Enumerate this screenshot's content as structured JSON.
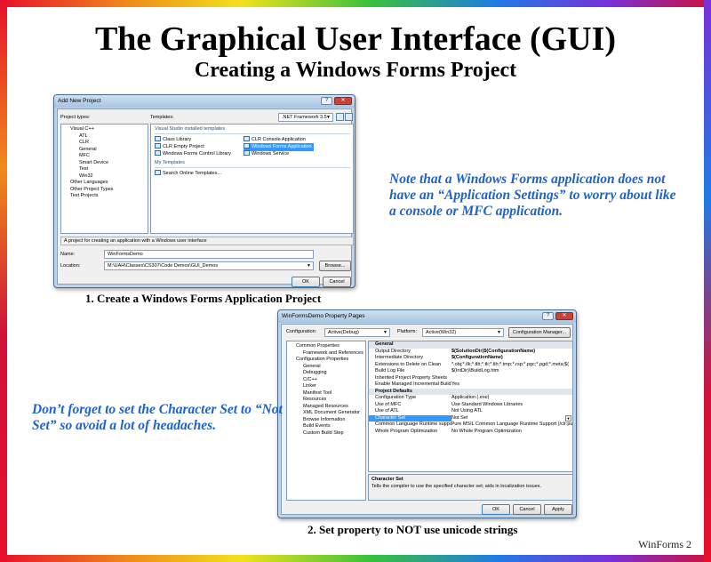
{
  "slide": {
    "title": "The Graphical User Interface (GUI)",
    "subtitle": "Creating a Windows Forms Project",
    "note_top": "Note that a Windows Forms application does not have an “Application Settings” to worry about like a console or MFC application.",
    "note_bottom": "Don’t forget to set the Character Set to “Not Set” so avoid a lot of headaches.",
    "caption_1": "1. Create a Windows Forms Application Project",
    "caption_2": "2. Set property to NOT use unicode strings",
    "slide_number": "WinForms 2"
  },
  "new_project_dialog": {
    "title": "Add New Project",
    "project_types_label": "Project types:",
    "project_types": [
      "Visual C++",
      "ATL",
      "CLR",
      "General",
      "MFC",
      "Smart Device",
      "Test",
      "Win32",
      "Other Languages",
      "Other Project Types",
      "Test Projects"
    ],
    "templates_label": "Templates:",
    "framework": ".NET Framework 3.5",
    "installed_header": "Visual Studio installed templates",
    "templates_col1": [
      "Class Library",
      "CLR Empty Project",
      "Windows Forms Control Library"
    ],
    "templates_col2": [
      "CLR Console Application",
      "Windows Forms Application",
      "Windows Service"
    ],
    "my_templates_header": "My Templates",
    "search_online": "Search Online Templates...",
    "description": "A project for creating an application with a Windows user interface",
    "name_label": "Name:",
    "name_value": "WinFormsDemo",
    "location_label": "Location:",
    "location_value": "M:\\UAH\\Classes\\CS307\\Code Demos\\GUI_Demos",
    "browse_label": "Browse...",
    "ok_label": "OK",
    "cancel_label": "Cancel"
  },
  "property_pages": {
    "title": "WinFormsDemo Property Pages",
    "configuration_label": "Configuration:",
    "configuration_value": "Active(Debug)",
    "platform_label": "Platform:",
    "platform_value": "Active(Win32)",
    "config_manager_label": "Configuration Manager...",
    "tree": [
      "Common Properties",
      "Framework and References",
      "Configuration Properties",
      "General",
      "Debugging",
      "C/C++",
      "Linker",
      "Manifest Tool",
      "Resources",
      "Managed Resources",
      "XML Document Generator",
      "Browse Information",
      "Build Events",
      "Custom Build Step"
    ],
    "general_header": "General",
    "general_props": [
      {
        "name": "Output Directory",
        "value": "$(SolutionDir)$(ConfigurationName)"
      },
      {
        "name": "Intermediate Directory",
        "value": "$(ConfigurationName)"
      },
      {
        "name": "Extensions to Delete on Clean",
        "value": "*.obj;*.ilk;*.tlb;*.tli;*.tlh;*.tmp;*.rsp;*.pgc;*.pgd;*.meta;$("
      },
      {
        "name": "Build Log File",
        "value": "$(IntDir)\\BuildLog.htm"
      },
      {
        "name": "Inherited Project Property Sheets",
        "value": ""
      },
      {
        "name": "Enable Managed Incremental Build",
        "value": "Yes"
      }
    ],
    "defaults_header": "Project Defaults",
    "default_props": [
      {
        "name": "Configuration Type",
        "value": "Application (.exe)"
      },
      {
        "name": "Use of MFC",
        "value": "Use Standard Windows Libraries"
      },
      {
        "name": "Use of ATL",
        "value": "Not Using ATL"
      },
      {
        "name": "Character Set",
        "value": "Not Set"
      },
      {
        "name": "Common Language Runtime support",
        "value": "Pure MSIL Common Language Runtime Support (/clr:pu"
      },
      {
        "name": "Whole Program Optimization",
        "value": "No Whole Program Optimization"
      }
    ],
    "desc_title": "Character Set",
    "desc_text": "Tells the compiler to use the specified character set; aids in localization issues.",
    "ok_label": "OK",
    "cancel_label": "Cancel",
    "apply_label": "Apply"
  }
}
